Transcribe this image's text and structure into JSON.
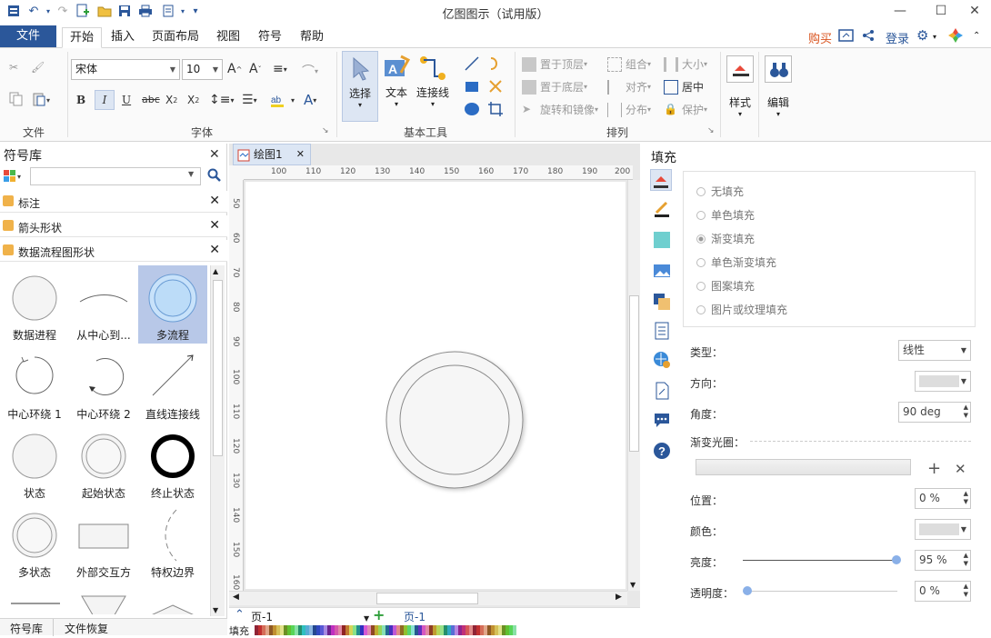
{
  "app": {
    "title": "亿图图示（试用版）"
  },
  "menu": {
    "file": "文件",
    "tabs": [
      "开始",
      "插入",
      "页面布局",
      "视图",
      "符号",
      "帮助"
    ],
    "buy": "购买",
    "login": "登录"
  },
  "ribbon": {
    "file_group": "文件",
    "font": {
      "name": "宋体",
      "size": "10",
      "group": "字体"
    },
    "tools": {
      "select": "选择",
      "text": "文本",
      "connector": "连接线",
      "group": "基本工具"
    },
    "arrange": {
      "top": "置于顶层",
      "bottom": "置于底层",
      "rotate": "旋转和镜像",
      "combine": "组合",
      "align": "对齐",
      "distribute": "分布",
      "size": "大小",
      "center": "居中",
      "protect": "保护",
      "group": "排列"
    },
    "style": "样式",
    "edit": "编辑"
  },
  "library": {
    "title": "符号库",
    "search_placeholder": "",
    "categories": [
      "标注",
      "箭头形状",
      "数据流程图形状"
    ],
    "shapes": [
      "数据进程",
      "从中心到...",
      "多流程",
      "中心环绕 1",
      "中心环绕 2",
      "直线连接线",
      "状态",
      "起始状态",
      "终止状态",
      "多状态",
      "外部交互方",
      "特权边界"
    ],
    "bottom_tabs": [
      "符号库",
      "文件恢复"
    ]
  },
  "canvas": {
    "doc_tab": "绘图1",
    "ruler_h": [
      "100",
      "110",
      "120",
      "130",
      "140",
      "150",
      "160",
      "170",
      "180",
      "190",
      "200"
    ],
    "ruler_v": [
      "50",
      "60",
      "70",
      "80",
      "90",
      "100",
      "110",
      "120",
      "130",
      "140",
      "150",
      "160"
    ],
    "page_selector": "页-1",
    "page_tab": "页-1",
    "palette_label": "填充"
  },
  "fill_panel": {
    "title": "填充",
    "options": [
      "无填充",
      "单色填充",
      "渐变填充",
      "单色渐变填充",
      "图案填充",
      "图片或纹理填充"
    ],
    "selected": "渐变填充",
    "type_label": "类型：",
    "type_value": "线性",
    "direction_label": "方向：",
    "angle_label": "角度：",
    "angle_value": "90 deg",
    "halo_label": "渐变光圈：",
    "position_label": "位置：",
    "position_value": "0 %",
    "color_label": "颜色：",
    "brightness_label": "亮度：",
    "brightness_value": "95 %",
    "transparency_label": "透明度：",
    "transparency_value": "0 %"
  }
}
